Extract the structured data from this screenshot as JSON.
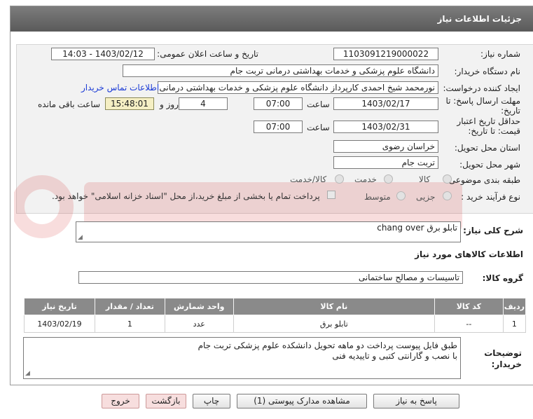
{
  "header": {
    "title": "جزئیات اطلاعات نیاز"
  },
  "form": {
    "need_number_label": "شماره نیاز:",
    "need_number": "1103091219000022",
    "announce_label": "تاریخ و ساعت اعلان عمومی:",
    "announce_value": "1403/02/12 - 14:03",
    "buyer_org_label": "نام دستگاه خریدار:",
    "buyer_org": "دانشگاه علوم پزشكی و خدمات بهداشتی  درمانی تربت جام",
    "requester_label": "ایجاد کننده درخواست:",
    "requester": "نورمحمد شیخ احمدی کارپرداز دانشگاه علوم پزشكی و خدمات بهداشتی  درمانی تربت جام",
    "contact_link": "اطلاعات تماس خریدار",
    "deadline_label_1": "مهلت ارسال پاسخ: تا",
    "deadline_label_2": "تاریخ:",
    "deadline_date": "1403/02/17",
    "time_label": "ساعت",
    "deadline_time": "07:00",
    "days_value": "4",
    "days_label": "روز و",
    "remaining_time": "15:48:01",
    "remaining_label": "ساعت باقی مانده",
    "validity_label_1": "حداقل تاریخ اعتبار",
    "validity_label_2": "قیمت: تا تاریخ:",
    "validity_date": "1403/02/31",
    "validity_time": "07:00",
    "province_label": "استان محل تحویل:",
    "province": "خراسان رضوی",
    "city_label": "شهر محل تحویل:",
    "city": "تربت جام",
    "category_label": "طبقه بندی موضوعی:",
    "category_options": [
      "کالا",
      "خدمت",
      "کالا/خدمت"
    ],
    "purchase_type_label": "نوع فرآیند خرید :",
    "purchase_options": [
      "جزیی",
      "متوسط"
    ],
    "payment_note": "پرداخت تمام یا بخشی از مبلغ خرید،از محل \"اسناد خزانه اسلامی\" خواهد بود."
  },
  "summary": {
    "label": "شرح کلی نیاز:",
    "value": "تابلو برق chang over"
  },
  "goods_info_title": "اطلاعات کالاهای مورد نیاز",
  "goods_group": {
    "label": "گروه کالا:",
    "value": "تاسیسات و مصالح ساختمانی"
  },
  "table": {
    "headers": [
      "ردیف",
      "کد کالا",
      "نام کالا",
      "واحد شمارش",
      "تعداد / مقدار",
      "تاریخ نیاز"
    ],
    "rows": [
      [
        "1",
        "--",
        "تابلو برق",
        "عدد",
        "1",
        "1403/02/19"
      ]
    ]
  },
  "notes": {
    "label_1": "توضیحات",
    "label_2": "خریدار:",
    "line_1": "طبق فایل پیوست پرداخت دو ماهه تحویل دانشکده علوم پزشکی تربت جام",
    "line_2": "با نصب و گارانتی کتبی و تاییدیه فنی"
  },
  "buttons": {
    "reply": "پاسخ به نیاز",
    "attachments": "مشاهده مدارک پیوستی (1)",
    "print": "چاپ",
    "back": "بازگشت",
    "exit": "خروج"
  },
  "colors": {
    "header": "#6b6b6b",
    "link": "#1a3ad6",
    "timer_bg": "#f5efc4",
    "table_header": "#8a8a8a"
  }
}
